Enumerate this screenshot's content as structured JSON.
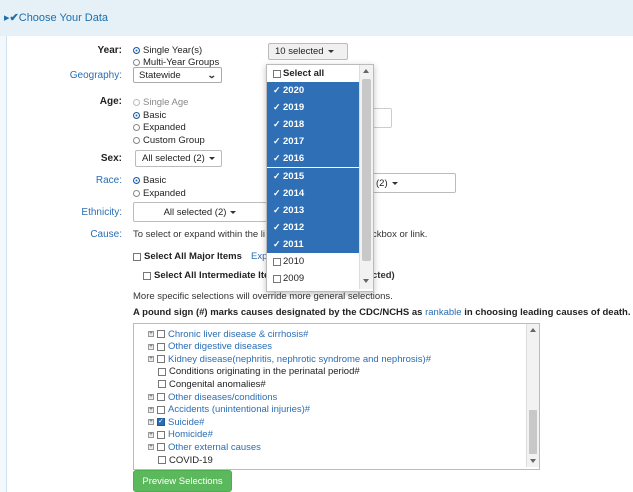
{
  "header": {
    "title": "Choose Your Data"
  },
  "year": {
    "label": "Year:",
    "options": [
      "Single Year(s)",
      "Multi-Year Groups"
    ],
    "dropdown_label": "10 selected",
    "select_all": "Select all",
    "years": [
      {
        "y": "2020",
        "checked": true
      },
      {
        "y": "2019",
        "checked": true
      },
      {
        "y": "2018",
        "checked": true
      },
      {
        "y": "2017",
        "checked": true
      },
      {
        "y": "2016",
        "checked": true
      },
      {
        "y": "2015",
        "checked": true
      },
      {
        "y": "2014",
        "checked": true
      },
      {
        "y": "2013",
        "checked": true
      },
      {
        "y": "2012",
        "checked": true
      },
      {
        "y": "2011",
        "checked": true
      },
      {
        "y": "2010",
        "checked": false
      },
      {
        "y": "2009",
        "checked": false
      }
    ]
  },
  "geography": {
    "label": "Geography:",
    "value": "Statewide"
  },
  "age": {
    "label": "Age:",
    "options": [
      "Single Age",
      "Basic",
      "Expanded",
      "Custom Group"
    ]
  },
  "sex": {
    "label": "Sex:",
    "value": "All selected (2)"
  },
  "race": {
    "label": "Race:",
    "options": [
      "Basic",
      "Expanded"
    ],
    "value_fragment": "(2)"
  },
  "ethnicity": {
    "label": "Ethnicity:",
    "value": "All selected (2)"
  },
  "cause": {
    "label": "Cause:",
    "instruction_start": "To select or expand within the li",
    "instruction_end": "ckbox or link.",
    "select_all_major": "Select All Major Items",
    "expand_fragment": "Exp",
    "select_all_intermediate": "Select All Intermediate Ite",
    "selected_fragment": "cted)",
    "override_note": "More specific selections will override more general selections.",
    "pound_note_start": "A pound sign (#) marks causes designated by the CDC/NCHS as ",
    "pound_note_link": "rankable",
    "pound_note_end": " in choosing leading causes of death.",
    "items": [
      {
        "label": "Chronic liver disease & cirrhosis#",
        "expandable": true,
        "checked": false,
        "link": true
      },
      {
        "label": "Other digestive diseases",
        "expandable": true,
        "checked": false,
        "link": true
      },
      {
        "label": "Kidney disease(nephritis, nephrotic syndrome and nephrosis)#",
        "expandable": true,
        "checked": false,
        "link": true
      },
      {
        "label": "Conditions originating in the perinatal period#",
        "expandable": false,
        "checked": false,
        "link": false
      },
      {
        "label": "Congenital anomalies#",
        "expandable": false,
        "checked": false,
        "link": false
      },
      {
        "label": "Other diseases/conditions",
        "expandable": true,
        "checked": false,
        "link": true
      },
      {
        "label": "Accidents (unintentional injuries)#",
        "expandable": true,
        "checked": false,
        "link": true
      },
      {
        "label": "Suicide#",
        "expandable": true,
        "checked": true,
        "link": true
      },
      {
        "label": "Homicide#",
        "expandable": true,
        "checked": false,
        "link": true
      },
      {
        "label": "Other external causes",
        "expandable": true,
        "checked": false,
        "link": true
      },
      {
        "label": "COVID-19",
        "expandable": false,
        "checked": false,
        "link": false
      }
    ]
  },
  "preview_button": "Preview Selections"
}
